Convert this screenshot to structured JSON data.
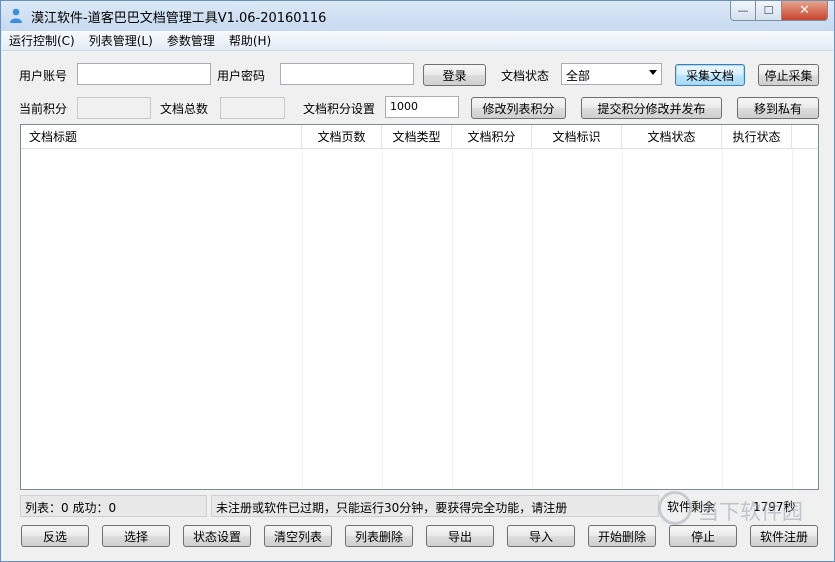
{
  "window": {
    "title": "漠江软件-道客巴巴文档管理工具V1.06-20160116",
    "controls": {
      "minimize": "—",
      "maximize": "☐",
      "close": "✕"
    }
  },
  "menu": [
    "运行控制(C)",
    "列表管理(L)",
    "参数管理",
    "帮助(H)"
  ],
  "login": {
    "user_label": "用户账号",
    "user_value": "",
    "password_label": "用户密码",
    "password_value": "",
    "login_button": "登录",
    "doc_status_label": "文档状态",
    "doc_status_value": "全部",
    "collect_button": "采集文档",
    "stop_collect_button": "停止采集"
  },
  "points": {
    "current_label": "当前积分",
    "current_value": "",
    "total_docs_label": "文档总数",
    "total_docs_value": "",
    "setting_label": "文档积分设置",
    "setting_value": "1000",
    "modify_list_button": "修改列表积分",
    "submit_button": "提交积分修改并发布",
    "private_button": "移到私有"
  },
  "table": {
    "columns": [
      "文档标题",
      "文档页数",
      "文档类型",
      "文档积分",
      "文档标识",
      "文档状态",
      "执行状态"
    ],
    "rows": []
  },
  "status": {
    "list_count": "列表：0  成功：0",
    "message": "未注册或软件已过期，只能运行30分钟，要获得完全功能，请注册",
    "remaining_label": "软件剩余",
    "remaining_value": "1797秒"
  },
  "bottom_buttons": [
    "反选",
    "选择",
    "状态设置",
    "清空列表",
    "列表删除",
    "导出",
    "导入",
    "开始删除",
    "停止",
    "软件注册"
  ],
  "watermark": "当下软件园"
}
